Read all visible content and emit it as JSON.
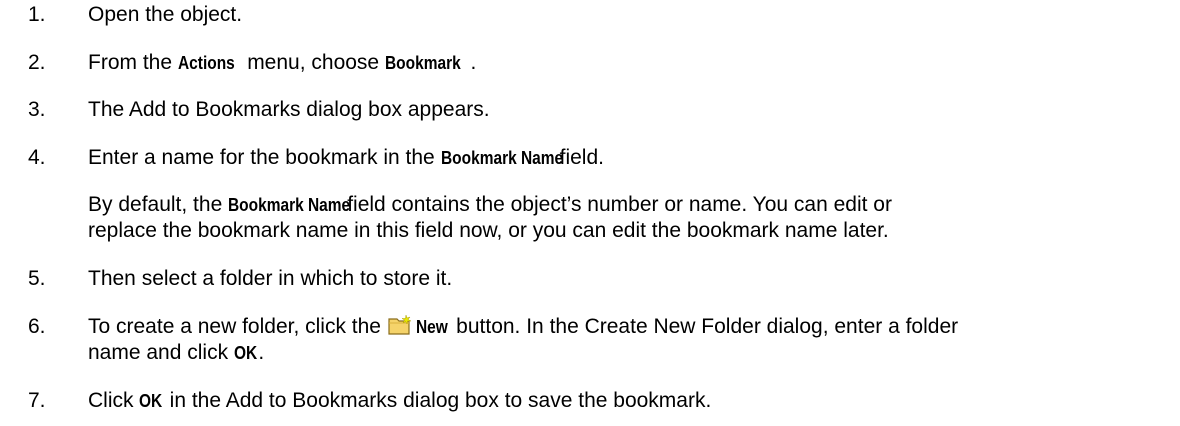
{
  "steps": [
    {
      "num": "1.",
      "text": "Open the object."
    },
    {
      "num": "2.",
      "t1": "From the ",
      "ui1": "Actions",
      "t2": " menu, choose ",
      "ui2": "Bookmark",
      "t3": "."
    },
    {
      "num": "3.",
      "text": "The Add to Bookmarks dialog box appears."
    },
    {
      "num": "4.",
      "t1": "Enter a name for the bookmark in the ",
      "ui1": "Bookmark Name",
      "t2": " field."
    },
    {
      "num": "5.",
      "text": "Then select a folder in which to store it."
    },
    {
      "num": "6.",
      "t1": "To create a new folder, click the ",
      "ui1": "New",
      "t2": " button. In the Create New Folder dialog, enter a folder",
      "t3": "name and click ",
      "ui2": "OK",
      "t4": "."
    },
    {
      "num": "7.",
      "t1": "Click ",
      "ui1": "OK",
      "t2": " in the Add to Bookmarks dialog box to save the bookmark."
    }
  ],
  "note": {
    "t1": "By default, the ",
    "ui1": "Bookmark Name",
    "t2": " field contains the object’s number or name. You can edit or",
    "t3": "replace the bookmark name in this field now, or you can edit the bookmark name later."
  },
  "icons": {
    "new_folder": "new-folder-icon"
  },
  "colors": {
    "folder_fill": "#f5d36a",
    "folder_stroke": "#8a6d1c",
    "star": "#e8e800"
  }
}
